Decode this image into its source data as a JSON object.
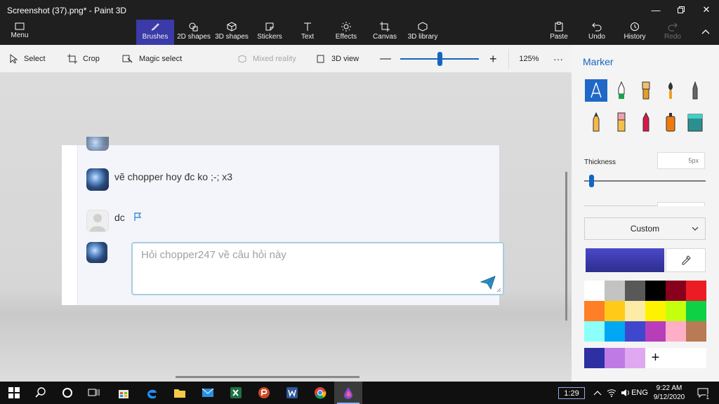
{
  "window": {
    "title": "Screenshot (37).png* - Paint 3D"
  },
  "ribbon": {
    "menu": "Menu",
    "tools": {
      "brushes": "Brushes",
      "shapes2d": "2D shapes",
      "shapes3d": "3D shapes",
      "stickers": "Stickers",
      "text": "Text",
      "effects": "Effects",
      "canvas": "Canvas",
      "library3d": "3D library"
    },
    "right": {
      "paste": "Paste",
      "undo": "Undo",
      "history": "History",
      "redo": "Redo"
    }
  },
  "toolbar": {
    "select": "Select",
    "crop": "Crop",
    "magic_select": "Magic select",
    "mixed_reality": "Mixed reality",
    "view3d": "3D view",
    "zoom_level": "125%",
    "zoom_fraction": 0.5
  },
  "canvas": {
    "comments": [
      {
        "text": "vẽ chopper hoy đc ko ;-;   x3"
      },
      {
        "text": "dc"
      }
    ],
    "input_placeholder": "Hỏi chopper247 về câu hỏi này"
  },
  "panel": {
    "title": "Marker",
    "brushes": [
      "calligraphy-pen",
      "marker",
      "oil-brush",
      "watercolor",
      "pencil",
      "crayon",
      "eraser",
      "pixel-pen",
      "spray-can",
      "fill"
    ],
    "thickness_label": "Thickness",
    "thickness_value": "5px",
    "color_mode": "Custom",
    "current_color": "#3e3cb4",
    "palette": [
      "#ffffff",
      "#c3c3c3",
      "#585858",
      "#000000",
      "#88001b",
      "#ec1c24",
      "#ff7f27",
      "#ffca18",
      "#fdeca6",
      "#fff200",
      "#c4ff0e",
      "#0ed145",
      "#8cfffb",
      "#00a8f3",
      "#3f48cc",
      "#b83dba",
      "#ffaec8",
      "#b97a56"
    ],
    "custom_colors": [
      "#2e2fa3",
      "#c07ae6",
      "#dfa8f0"
    ]
  },
  "taskbar": {
    "tray_time_box": "1:29",
    "language": "ENG",
    "clock_time": "9:22 AM",
    "clock_date": "9/12/2020",
    "notification_count": "1"
  }
}
